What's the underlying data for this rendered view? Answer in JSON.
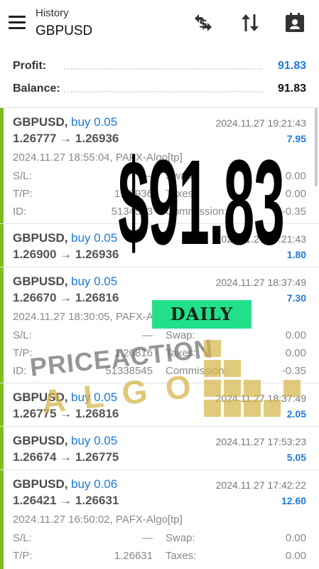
{
  "header": {
    "subtitle": "History",
    "title": "GBPUSD",
    "icons": [
      "menu-icon",
      "currency-exchange-icon",
      "sort-arrows-icon",
      "account-card-icon"
    ]
  },
  "summary": {
    "profit_label": "Profit:",
    "profit_value": "91.83",
    "balance_label": "Balance:",
    "balance_value": "91.83"
  },
  "colors": {
    "accent_blue": "#1e7ad8",
    "buy_bar_green": "#7cbf1c",
    "badge_green": "#22e08a",
    "logo_gold": "#d4b446"
  },
  "trades": [
    {
      "symbol": "GBPUSD,",
      "side": "buy 0.05",
      "time": "2024.11.27 19:21:43",
      "prices": "1.26777 → 1.26936",
      "profit": "7.95",
      "open": "2024.11.27 18:55:04, PAFX-Algo[tp]",
      "sl_label": "S/L:",
      "sl": "—",
      "swap_label": "Swap:",
      "swap": "0.00",
      "tp_label": "T/P:",
      "tp": "1.26936",
      "taxes_label": "Taxes:",
      "taxes": "0.00",
      "id_label": "ID:",
      "id": "5134583",
      "commission_label": "Commission:",
      "commission": "-0.35"
    },
    {
      "symbol": "GBPUSD,",
      "side": "buy 0.05",
      "time": "2024.11.27 19:21:43",
      "prices": "1.26900 → 1.26936",
      "profit": "1.80"
    },
    {
      "symbol": "GBPUSD,",
      "side": "buy 0.05",
      "time": "2024.11.27 18:37:49",
      "prices": "1.26670 → 1.26816",
      "profit": "7.30",
      "open": "2024.11.27 18:30:05, PAFX-Algo[tp]",
      "sl_label": "S/L:",
      "sl": "—",
      "swap_label": "Swap:",
      "swap": "0.00",
      "tp_label": "T/P:",
      "tp": "1.26816",
      "taxes_label": "Taxes:",
      "taxes": "0.00",
      "id_label": "ID:",
      "id": "51338545",
      "commission_label": "Commission:",
      "commission": "-0.35"
    },
    {
      "symbol": "GBPUSD,",
      "side": "buy 0.05",
      "time": "2024.11.27 18:37:49",
      "prices": "1.26775 → 1.26816",
      "profit": "2.05"
    },
    {
      "symbol": "GBPUSD,",
      "side": "buy 0.05",
      "time": "2024.11.27 17:53:23",
      "prices": "1.26674 → 1.26775",
      "profit": "5.05"
    },
    {
      "symbol": "GBPUSD,",
      "side": "buy 0.06",
      "time": "2024.11.27 17:42:22",
      "prices": "1.26421 → 1.26631",
      "profit": "12.60",
      "open": "2024.11.27 16:50:02, PAFX-Algo[tp]",
      "sl_label": "S/L:",
      "sl": "—",
      "swap_label": "Swap:",
      "swap": "0.00",
      "tp_label": "T/P:",
      "tp": "1.26631",
      "taxes_label": "Taxes:",
      "taxes": "0.00"
    }
  ],
  "overlay": {
    "amount": "$91.83",
    "badge": "DAILY",
    "logo_line1": "PRICEACTION",
    "logo_line2": "ALGO"
  }
}
